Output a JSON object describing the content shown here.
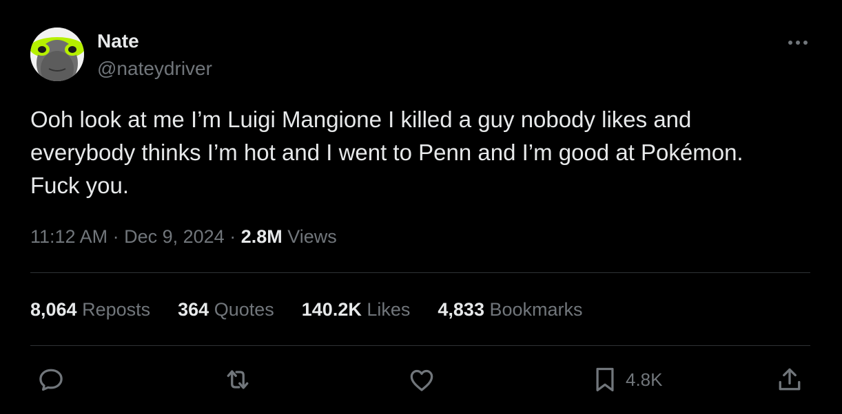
{
  "author": {
    "display_name": "Nate",
    "handle": "@nateydriver"
  },
  "tweet": {
    "text": "Ooh look at me I’m Luigi Mangione I killed a guy nobody likes and\neverybody thinks I’m hot and I went to Penn and I’m good at Pokémon.\nFuck you.",
    "time": "11:12 AM",
    "separator": " · ",
    "date": "Dec 9, 2024",
    "views_count": "2.8M",
    "views_label": " Views"
  },
  "stats": {
    "reposts_count": "8,064",
    "reposts_label": " Reposts",
    "quotes_count": "364",
    "quotes_label": " Quotes",
    "likes_count": "140.2K",
    "likes_label": " Likes",
    "bookmarks_count": "4,833",
    "bookmarks_label": " Bookmarks"
  },
  "actions": {
    "bookmark_count": "4.8K"
  },
  "icons": {
    "more": "more-horizontal-icon",
    "reply": "reply-icon",
    "repost": "repost-icon",
    "like": "heart-icon",
    "bookmark": "bookmark-icon",
    "share": "share-icon"
  },
  "colors": {
    "background": "#000000",
    "text_primary": "#e7e9ea",
    "text_secondary": "#71767b",
    "divider": "#2f3336",
    "avatar_accent": "#b6f000"
  }
}
